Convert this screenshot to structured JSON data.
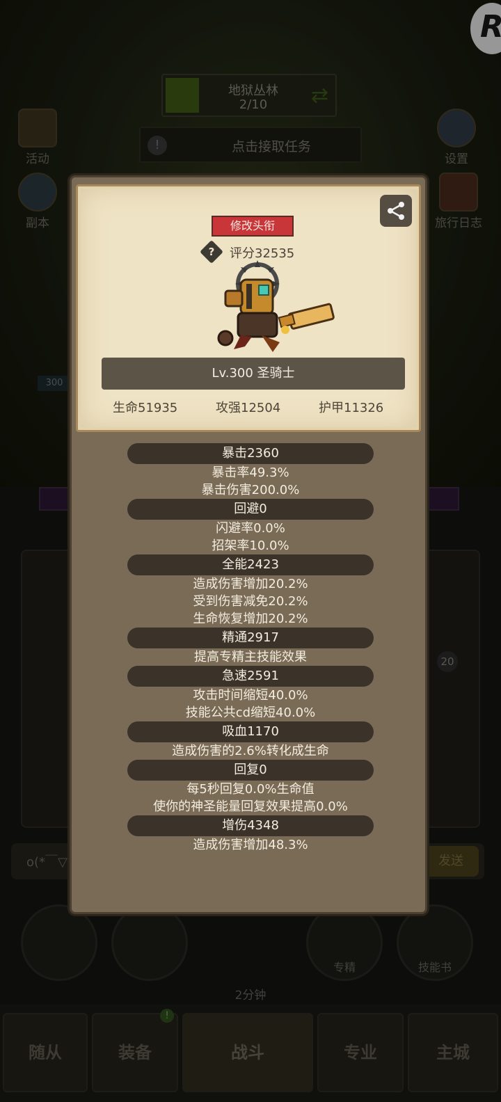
{
  "stage": {
    "name": "地狱丛林",
    "progress": "2/10"
  },
  "task": {
    "label": "点击接取任务"
  },
  "side_left": [
    {
      "label": "活动"
    },
    {
      "label": "副本"
    }
  ],
  "side_right": [
    {
      "label": "设置"
    },
    {
      "label": "旅行日志"
    }
  ],
  "chat": {
    "preview": "o(*￣▽",
    "send_label": "发送"
  },
  "actions": [
    {
      "label": ""
    },
    {
      "label": ""
    },
    {
      "label": "2分钟"
    },
    {
      "label": "专精"
    },
    {
      "label": "技能书"
    }
  ],
  "nav": [
    {
      "label": "随从"
    },
    {
      "label": "装备"
    },
    {
      "label": "战斗"
    },
    {
      "label": "专业"
    },
    {
      "label": "主城"
    }
  ],
  "nav_badge": "!",
  "slot_badge": "20",
  "level_badge": "300",
  "popup": {
    "title_button": "修改头衔",
    "help_icon": "?",
    "score": "评分32535",
    "name": "Lv.300 圣骑士",
    "stats": {
      "hp": "生命51935",
      "atk": "攻强12504",
      "armor": "护甲11326"
    },
    "attributes": [
      {
        "pill": "暴击2360",
        "lines": [
          "暴击率49.3%",
          "暴击伤害200.0%"
        ]
      },
      {
        "pill": "回避0",
        "lines": [
          "闪避率0.0%",
          "招架率10.0%"
        ]
      },
      {
        "pill": "全能2423",
        "lines": [
          "造成伤害增加20.2%",
          "受到伤害减免20.2%",
          "生命恢复增加20.2%"
        ]
      },
      {
        "pill": "精通2917",
        "lines": [
          "提高专精主技能效果"
        ]
      },
      {
        "pill": "急速2591",
        "lines": [
          "攻击时间缩短40.0%",
          "技能公共cd缩短40.0%"
        ]
      },
      {
        "pill": "吸血1170",
        "lines": [
          "造成伤害的2.6%转化成生命"
        ]
      },
      {
        "pill": "回复0",
        "lines": [
          "每5秒回复0.0%生命值",
          "使你的神圣能量回复效果提高0.0%"
        ]
      },
      {
        "pill": "增伤4348",
        "lines": [
          "造成伤害增加48.3%"
        ]
      }
    ]
  },
  "colors": {
    "title_button": "#c8363a",
    "card": "#efe3c5",
    "panel": "#796b55",
    "pill": "#3b332a"
  },
  "icons": {
    "share": "share-icon",
    "help": "help-diamond-icon",
    "refresh": "refresh-icon",
    "settings": "gear-icon"
  }
}
